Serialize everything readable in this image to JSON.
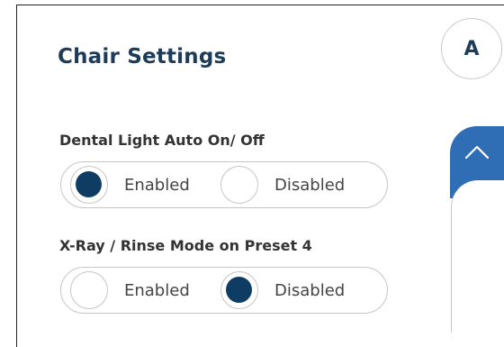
{
  "header": {
    "title": "Chair Settings",
    "avatar_initial": "A"
  },
  "settings": [
    {
      "label": "Dental Light Auto On/ Off",
      "options": [
        "Enabled",
        "Disabled"
      ],
      "selected": "Enabled"
    },
    {
      "label": "X-Ray / Rinse Mode on Preset 4",
      "options": [
        "Enabled",
        "Disabled"
      ],
      "selected": "Disabled"
    }
  ],
  "colors": {
    "title": "#1d3c5a",
    "radio_fill": "#0f3c63",
    "scroll_accent": "#2f6db5",
    "border": "#c6c6c6"
  },
  "icons": {
    "scroll_up": "chevron-up-icon"
  }
}
